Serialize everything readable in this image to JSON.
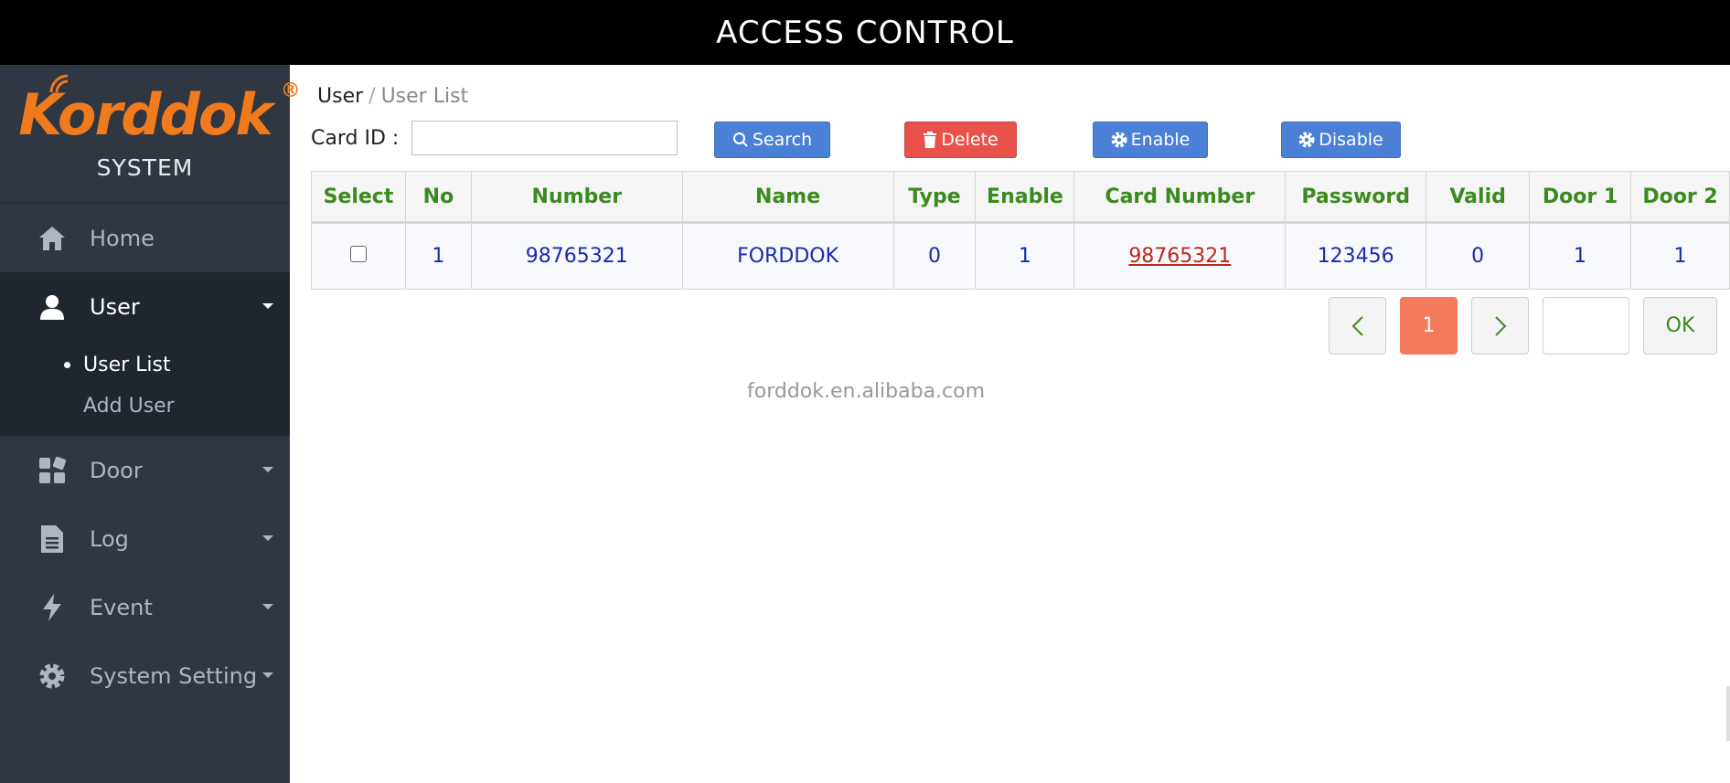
{
  "header": {
    "title": "ACCESS CONTROL"
  },
  "brand": {
    "logo_text": "Korddok",
    "registered": "®",
    "subtitle": "SYSTEM"
  },
  "sidebar": {
    "items": [
      {
        "label": "Home",
        "icon": "home-icon"
      },
      {
        "label": "User",
        "icon": "user-icon",
        "active": true,
        "children": [
          {
            "label": "User List",
            "active": true
          },
          {
            "label": "Add User"
          }
        ]
      },
      {
        "label": "Door",
        "icon": "grid-icon"
      },
      {
        "label": "Log",
        "icon": "document-icon"
      },
      {
        "label": "Event",
        "icon": "bolt-icon"
      },
      {
        "label": "System Setting",
        "icon": "gear-icon"
      }
    ]
  },
  "breadcrumb": {
    "parent": "User",
    "separator": "/",
    "current": "User List"
  },
  "filter": {
    "label": "Card ID :",
    "value": "",
    "placeholder": ""
  },
  "toolbar": {
    "search_label": "Search",
    "delete_label": "Delete",
    "enable_label": "Enable",
    "disable_label": "Disable"
  },
  "table": {
    "columns": [
      "Select",
      "No",
      "Number",
      "Name",
      "Type",
      "Enable",
      "Card Number",
      "Password",
      "Valid",
      "Door 1",
      "Door 2"
    ],
    "rows": [
      {
        "no": "1",
        "number": "98765321",
        "name": "FORDDOK",
        "type": "0",
        "enable": "1",
        "card_number": "98765321",
        "password": "123456",
        "valid": "0",
        "door1": "1",
        "door2": "1"
      }
    ]
  },
  "pagination": {
    "prev": "‹",
    "current": "1",
    "next": "›",
    "ok_label": "OK",
    "goto_value": ""
  },
  "watermark": "forddok.en.alibaba.com",
  "colors": {
    "accent": "#4a80d6",
    "danger": "#e9524a",
    "logo": "#f07a1c",
    "header_text": "#3b8a1f",
    "page_active": "#f37a5a"
  }
}
